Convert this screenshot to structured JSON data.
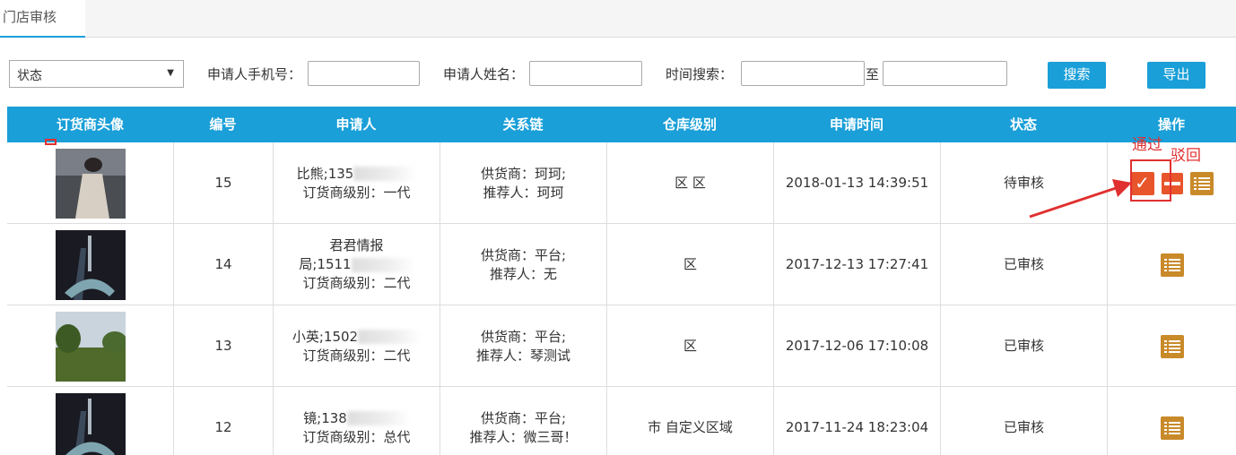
{
  "tab": {
    "label": "门店审核"
  },
  "filters": {
    "status_select": "状态",
    "phone_label": "申请人手机号：",
    "name_label": "申请人姓名：",
    "time_label": "时间搜索：",
    "to_label": "至",
    "search_button": "搜索",
    "export_button": "导出"
  },
  "table": {
    "headers": [
      "订货商头像",
      "编号",
      "申请人",
      "关系链",
      "仓库级别",
      "申请时间",
      "状态",
      "操作"
    ],
    "rows": [
      {
        "id": "15",
        "applicant_l1": "比熊;135",
        "applicant_l2": "订货商级别：一代",
        "chain_l1": "供货商：珂珂;",
        "chain_l2": "推荐人：珂珂",
        "level": "区 区",
        "time": "2018-01-13 14:39:51",
        "status": "待审核"
      },
      {
        "id": "14",
        "applicant_l1": "君君情报",
        "applicant_l1b": "局;1511",
        "applicant_l2": "订货商级别：二代",
        "chain_l1": "供货商：平台;",
        "chain_l2": "推荐人：无",
        "level": "区",
        "time": "2017-12-13 17:27:41",
        "status": "已审核"
      },
      {
        "id": "13",
        "applicant_l1": "小英;1502",
        "applicant_l2": "订货商级别：二代",
        "chain_l1": "供货商：平台;",
        "chain_l2": "推荐人：琴测试",
        "level": "区",
        "time": "2017-12-06 17:10:08",
        "status": "已审核"
      },
      {
        "id": "12",
        "applicant_l1": "镜;138",
        "applicant_l2": "订货商级别：总代",
        "chain_l1": "供货商：平台;",
        "chain_l2": "推荐人：微三哥！",
        "level": "市 自定义区域",
        "time": "2017-11-24 18:23:04",
        "status": "已审核"
      }
    ]
  },
  "annotations": {
    "pass": "通过",
    "reject": "驳回"
  },
  "colors": {
    "accent": "#1a9fd8",
    "action_orange": "#e8552a",
    "action_gold": "#c98a2a",
    "annotation_red": "#e03030"
  }
}
